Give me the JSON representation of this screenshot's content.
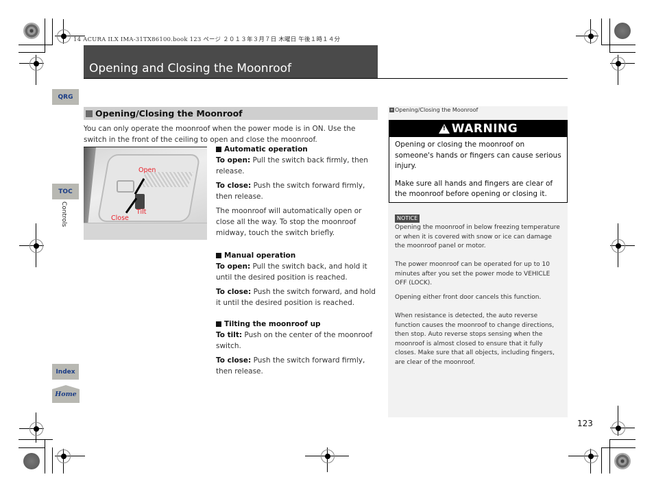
{
  "book_header": "14 ACURA ILX IMA-31TX86100.book  123 ページ  ２０１３年３月７日  木曜日  午後１時１４分",
  "page_title": "Opening and Closing the Moonroof",
  "nav": {
    "qrg": "QRG",
    "toc": "TOC",
    "index": "Index",
    "home": "Home",
    "section_label": "Controls"
  },
  "section": {
    "heading": "Opening/Closing the Moonroof",
    "intro": "You can only operate the moonroof when the power mode is in ON. Use the switch in the front of the ceiling to open and close the moonroof."
  },
  "figure": {
    "labels": {
      "open": "Open",
      "tilt": "Tilt",
      "close": "Close"
    }
  },
  "automatic": {
    "heading": "Automatic operation",
    "open_label": "To open:",
    "open_text": " Pull the switch back firmly, then release.",
    "close_label": "To close:",
    "close_text": " Push the switch forward firmly, then release.",
    "note": "The moonroof will automatically open or close all the way. To stop the moonroof midway, touch the switch briefly."
  },
  "manual": {
    "heading": "Manual operation",
    "open_label": "To open:",
    "open_text": " Pull the switch back, and hold it until the desired position is reached.",
    "close_label": "To close:",
    "close_text": " Push the switch forward, and hold it until the desired position is reached."
  },
  "tilting": {
    "heading": "Tilting the moonroof up",
    "tilt_label": "To tilt:",
    "tilt_text": " Push on the center of the moonroof switch.",
    "close_label": "To close:",
    "close_text": " Push the switch forward firmly, then release."
  },
  "sidebar": {
    "ref": "Opening/Closing the Moonroof",
    "warning": {
      "title": "WARNING",
      "p1": "Opening or closing the moonroof on someone's hands or fingers can cause serious injury.",
      "p2": "Make sure all hands and fingers are clear of the moonroof before opening or closing it."
    },
    "notice_label": "NOTICE",
    "notice_text": "Opening the moonroof in below freezing temperature or when it is covered with snow or ice can damage the moonroof panel or motor.",
    "p_power": "The power moonroof can be operated for up to 10 minutes after you set the power mode to VEHICLE OFF (LOCK).",
    "p_door": "Opening either front door cancels this function.",
    "p_reverse": "When resistance is detected, the auto reverse function causes the moonroof to change directions, then stop. Auto reverse stops sensing when the moonroof is almost closed to ensure that it fully closes. Make sure that all objects, including fingers, are clear of the moonroof."
  },
  "page_number": "123"
}
